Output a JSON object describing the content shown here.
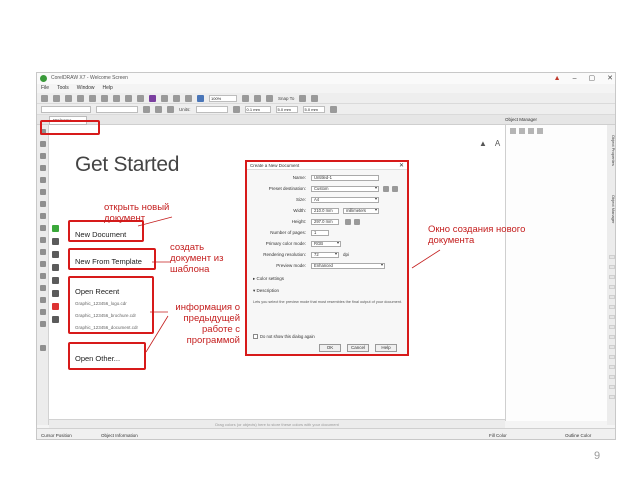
{
  "window": {
    "title": "CorelDRAW X7 - Welcome Screen",
    "controls": [
      "▲",
      "–",
      "▢",
      "✕"
    ]
  },
  "menu": [
    "File",
    "Tools",
    "Window",
    "Help"
  ],
  "toolbar": {
    "zoom_value": "100%",
    "snap_to": "Snap To",
    "units_label": "Units:",
    "nudge_value": "0.1 mm",
    "dup_x": "5.0 mm",
    "dup_y": "5.0 mm"
  },
  "tabs": {
    "welcome": "Welcome Screen",
    "object_manager": "Object Manager"
  },
  "welcome": {
    "heading": "Get Started",
    "new_document": "New Document",
    "new_from_template": "New From Template",
    "open_recent": "Open Recent",
    "recent_files": [
      "Graphic_123456_logo.cdr",
      "Graphic_123456_brochure.cdr",
      "Graphic_123456_document.cdr"
    ],
    "open_other": "Open Other..."
  },
  "annotations": {
    "open_new_doc": "открыть новый документ",
    "create_from_template": "создать документ из шаблона",
    "previous_work_info": "информация о предыдущей работе с программой",
    "new_doc_window": "Окно создания нового документа"
  },
  "dialog": {
    "title": "Create a New Document",
    "fields": {
      "name_label": "Name:",
      "name_value": "Untitled-1",
      "preset_label": "Preset destination:",
      "preset_value": "Custom",
      "size_label": "Size:",
      "size_value": "A4",
      "width_label": "Width:",
      "width_value": "210.0 mm",
      "width_unit": "millimeters",
      "height_label": "Height:",
      "height_value": "297.0 mm",
      "pages_label": "Number of pages:",
      "pages_value": "1",
      "color_mode_label": "Primary color mode:",
      "color_mode_value": "RGB",
      "resolution_label": "Rendering resolution:",
      "resolution_value": "72",
      "resolution_unit": "dpi",
      "preview_label": "Preview mode:",
      "preview_value": "Enhanced"
    },
    "color_settings": "Color settings",
    "description_title": "Description",
    "description_text": "Lets you select the preview mode that most resembles the final output of your document.",
    "dont_show": "Do not show this dialog again",
    "ok": "OK",
    "cancel": "Cancel",
    "help": "Help"
  },
  "side_tabs": [
    "Object Properties",
    "Object Manager"
  ],
  "hint_bar": "Drag colors (or objects) here to store these colors with your document",
  "status": {
    "cursor_position": "Cursor Position",
    "object_information": "Object Information",
    "fill_color": "Fill Color",
    "outline_color": "Outline Color"
  },
  "slide_number": "9",
  "colors": {
    "highlight": "#d71a1a",
    "annotation_text": "#c41e1e"
  }
}
